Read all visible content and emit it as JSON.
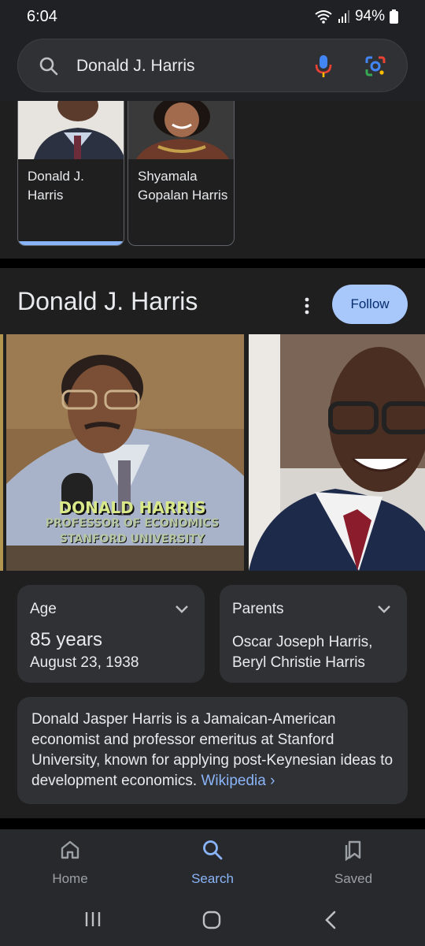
{
  "status_bar": {
    "time": "6:04",
    "battery": "94%"
  },
  "search": {
    "query": "Donald J. Harris"
  },
  "people_cards": [
    {
      "name": "Donald J. Harris"
    },
    {
      "name": "Shyamala Gopalan Harris"
    }
  ],
  "knowledge_panel": {
    "title": "Donald J. Harris",
    "follow_label": "Follow",
    "image_caption_lines": [
      "DONALD HARRIS",
      "PROFESSOR OF ECONOMICS",
      "STANFORD UNIVERSITY"
    ],
    "facts": [
      {
        "label": "Age",
        "value": "85 years",
        "sub": "August 23, 1938"
      },
      {
        "label": "Parents",
        "value": "Oscar Joseph Harris, Beryl Christie Harris"
      }
    ],
    "description": "Donald Jasper Harris is a Jamaican-American economist and professor emeritus at Stanford University, known for applying post-Keynesian ideas to development economics.",
    "source_link": "Wikipedia ›"
  },
  "bottom_nav": [
    {
      "label": "Home",
      "icon": "home-icon"
    },
    {
      "label": "Search",
      "icon": "search-icon",
      "active": true
    },
    {
      "label": "Saved",
      "icon": "bookmark-icon"
    }
  ],
  "colors": {
    "accent": "#8ab4f8",
    "follow_bg": "#a8c7fa",
    "surface": "#303134"
  }
}
